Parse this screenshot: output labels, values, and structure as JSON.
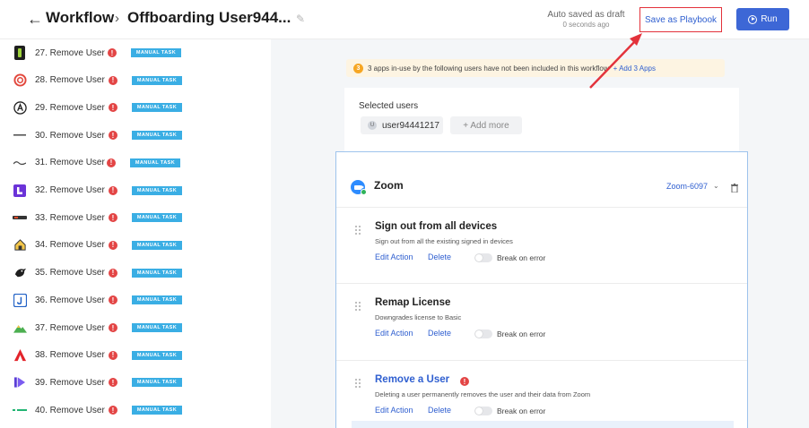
{
  "header": {
    "title": "Workflow",
    "workflow_name": "Offboarding User944...",
    "autosave_status": "Auto saved as draft",
    "autosave_time": "0 seconds ago",
    "save_playbook_label": "Save as Playbook",
    "run_label": "Run"
  },
  "sidebar": {
    "items": [
      {
        "label": "27. Remove User",
        "badge": "MANUAL TASK",
        "icon": "green-bottle-icon"
      },
      {
        "label": "28. Remove User",
        "badge": "MANUAL TASK",
        "icon": "red-spiral-icon"
      },
      {
        "label": "29. Remove User",
        "badge": "MANUAL TASK",
        "icon": "circle-a-icon"
      },
      {
        "label": "30. Remove User",
        "badge": "MANUAL TASK",
        "icon": "dash-logo-icon"
      },
      {
        "label": "31. Remove User",
        "badge": "MANUAL TASK",
        "icon": "script-logo-icon"
      },
      {
        "label": "32. Remove User",
        "badge": "MANUAL TASK",
        "icon": "purple-square-icon"
      },
      {
        "label": "33. Remove User",
        "badge": "MANUAL TASK",
        "icon": "wordmark-logo-icon"
      },
      {
        "label": "34. Remove User",
        "badge": "MANUAL TASK",
        "icon": "house-icon"
      },
      {
        "label": "35. Remove User",
        "badge": "MANUAL TASK",
        "icon": "bird-icon"
      },
      {
        "label": "36. Remove User",
        "badge": "MANUAL TASK",
        "icon": "j-square-icon"
      },
      {
        "label": "37. Remove User",
        "badge": "MANUAL TASK",
        "icon": "mountain-icon"
      },
      {
        "label": "38. Remove User",
        "badge": "MANUAL TASK",
        "icon": "red-a-icon"
      },
      {
        "label": "39. Remove User",
        "badge": "MANUAL TASK",
        "icon": "purple-play-icon"
      },
      {
        "label": "40. Remove User",
        "badge": "MANUAL TASK",
        "icon": "green-dash-icon"
      }
    ]
  },
  "notice": {
    "count": "3",
    "text": "3 apps in-use by the following users have not been included in this workflow",
    "link": "+ Add 3 Apps"
  },
  "users": {
    "title": "Selected users",
    "user_initial": "U",
    "user_name": "user94441217",
    "add_more": "+ Add more"
  },
  "app": {
    "name": "Zoom",
    "instance": "Zoom-6097",
    "edit_label": "Edit Action",
    "delete_label": "Delete",
    "break_label": "Break on error",
    "actions": [
      {
        "title": "Sign out from all devices",
        "desc": "Sign out from all the existing signed in devices"
      },
      {
        "title": "Remap License",
        "desc": "Downgrades license to Basic"
      },
      {
        "title": "Remove a User",
        "desc": "Deleting a user permanently removes the user and their data from Zoom"
      }
    ]
  },
  "colors": {
    "accent": "#3d67d6",
    "link": "#2f5fd0",
    "warning": "#e34545",
    "badge": "#3aaee4",
    "annotation": "#e3323b"
  }
}
